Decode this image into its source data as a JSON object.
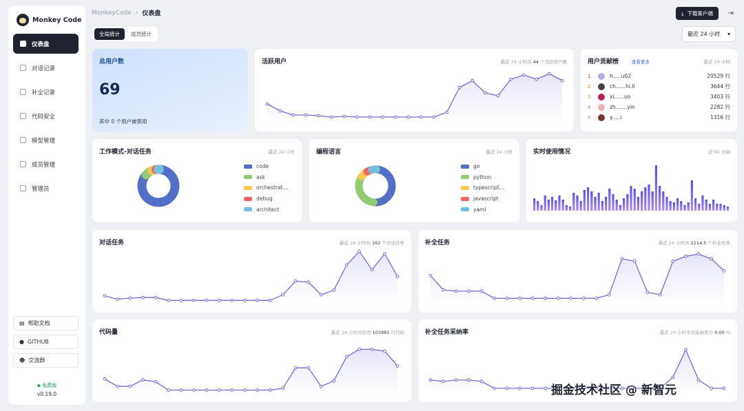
{
  "app": {
    "name": "Monkey Code"
  },
  "sidebar": {
    "items": [
      {
        "label": "仪表盘",
        "active": true
      },
      {
        "label": "对话记录"
      },
      {
        "label": "补全记录"
      },
      {
        "label": "代码安全"
      },
      {
        "label": "模型管理"
      },
      {
        "label": "成员管理"
      },
      {
        "label": "管理员"
      }
    ],
    "links": [
      {
        "label": "帮助文档",
        "icon": "book-icon"
      },
      {
        "label": "GITHUB",
        "icon": "github-icon"
      },
      {
        "label": "交流群",
        "icon": "group-icon"
      }
    ],
    "tier": "免费版",
    "version": "v0.19.0"
  },
  "breadcrumb": {
    "root": "MonkeyCode",
    "sep": "›",
    "current": "仪表盘"
  },
  "header": {
    "download_label": "下载客户端"
  },
  "tabs": [
    {
      "label": "全局统计",
      "active": true
    },
    {
      "label": "成员统计"
    }
  ],
  "range_select": {
    "value": "最近 24 小时"
  },
  "colors": {
    "accent": "#6f6cd8",
    "dark": "#1f2430"
  },
  "total_users": {
    "title": "总用户数",
    "value": "69",
    "note": "其中 0 个用户被禁用"
  },
  "active_users": {
    "title": "活跃用户",
    "subtitle": {
      "pre": "最近 24 小时共",
      "count": "44",
      "post": "个活跃用户数"
    },
    "values": [
      13,
      8,
      5,
      5,
      4.5,
      3.5,
      4,
      3.5,
      3.5,
      3.5,
      3.5,
      3.5,
      3.5,
      3.5,
      7,
      25,
      30,
      21,
      19,
      31,
      34,
      31,
      35,
      30
    ]
  },
  "ranking": {
    "title": "用户贡献榜",
    "more": "查看更多",
    "subtitle": "最近 24 小时",
    "rows": [
      {
        "rank": "1",
        "name": "h.....u02",
        "value": "20529 行",
        "color": "#b9a9e8"
      },
      {
        "rank": "2",
        "name": "ch......hi.li",
        "value": "3644 行",
        "color": "#444444"
      },
      {
        "rank": "3",
        "name": "xi......uo",
        "value": "3403 行",
        "color": "#b0245a"
      },
      {
        "rank": "4",
        "name": "zh.......yin",
        "value": "2282 行",
        "color": "#f0b3b3"
      },
      {
        "rank": "5",
        "name": "y.....i",
        "value": "1316 行",
        "color": "#7a3a2a"
      }
    ]
  },
  "work_mode": {
    "title": "工作模式-对话任务",
    "subtitle": "最近 24 小时",
    "slices": [
      {
        "name": "code",
        "value": 85,
        "color": "#5470c6"
      },
      {
        "name": "ask",
        "value": 7,
        "color": "#91cc75"
      },
      {
        "name": "orchestrat...",
        "value": 4,
        "color": "#fac858"
      },
      {
        "name": "debug",
        "value": 2,
        "color": "#ee6666"
      },
      {
        "name": "architect",
        "value": 2,
        "color": "#73c0de"
      }
    ]
  },
  "languages": {
    "title": "编程语言",
    "subtitle": "最近 24 小时",
    "slices": [
      {
        "name": "go",
        "value": 50,
        "color": "#5470c6"
      },
      {
        "name": "python",
        "value": 33,
        "color": "#91cc75"
      },
      {
        "name": "typescript...",
        "value": 7,
        "color": "#fac858"
      },
      {
        "name": "javascript",
        "value": 5,
        "color": "#ee6666"
      },
      {
        "name": "yaml",
        "value": 5,
        "color": "#73c0de"
      }
    ]
  },
  "realtime": {
    "title": "实时使用情况",
    "subtitle": "近 60 分钟",
    "values": [
      18,
      14,
      8,
      22,
      16,
      20,
      15,
      22,
      16,
      8,
      6,
      26,
      22,
      14,
      30,
      34,
      28,
      20,
      26,
      14,
      20,
      32,
      24,
      16,
      8,
      18,
      24,
      36,
      32,
      20,
      28,
      34,
      38,
      28,
      66,
      36,
      28,
      20,
      14,
      12,
      18,
      14,
      8,
      12,
      44,
      18,
      10,
      22,
      16,
      10,
      16,
      10,
      10,
      8,
      6
    ]
  },
  "chat_tasks": {
    "title": "对话任务",
    "subtitle": {
      "pre": "最近 24 小时共",
      "count": "162",
      "post": "个对话任务"
    },
    "values": [
      5,
      2,
      3,
      3.5,
      3.5,
      1,
      1,
      1,
      1,
      1,
      1,
      1,
      1,
      1,
      6,
      18,
      17,
      6,
      10,
      32,
      44,
      28,
      42,
      22
    ]
  },
  "completion_tasks": {
    "title": "补全任务",
    "subtitle": {
      "pre": "最近 24 小时共",
      "count": "2114.5",
      "post": "个补全任务"
    },
    "values": [
      24,
      12,
      11,
      11,
      11,
      5,
      5,
      5,
      5,
      5,
      5,
      5,
      5,
      5,
      8,
      38,
      36,
      10,
      8,
      36,
      40,
      42,
      38,
      28
    ]
  },
  "code_lines": {
    "title": "代码量",
    "subtitle": {
      "pre": "最近 24 小时共修改",
      "count": "103981",
      "post": "行代码"
    },
    "values": [
      8,
      4,
      4,
      7.5,
      6.5,
      2,
      2,
      2,
      2,
      2,
      2,
      2,
      2,
      2,
      3,
      14,
      14,
      4,
      7,
      20,
      24,
      24,
      23,
      15
    ]
  },
  "adoption": {
    "title": "补全任务采纳率",
    "subtitle": {
      "pre": "最近 24 小时平均采纳率为",
      "count": "0.00",
      "post": "%"
    },
    "values": [
      4,
      3.5,
      4,
      4,
      3.5,
      1,
      1,
      1,
      1,
      1,
      1,
      1,
      1,
      1,
      1,
      1,
      1,
      1,
      1,
      5,
      15,
      4,
      1,
      1
    ]
  },
  "watermark": "掘金技术社区 @ 新智元"
}
